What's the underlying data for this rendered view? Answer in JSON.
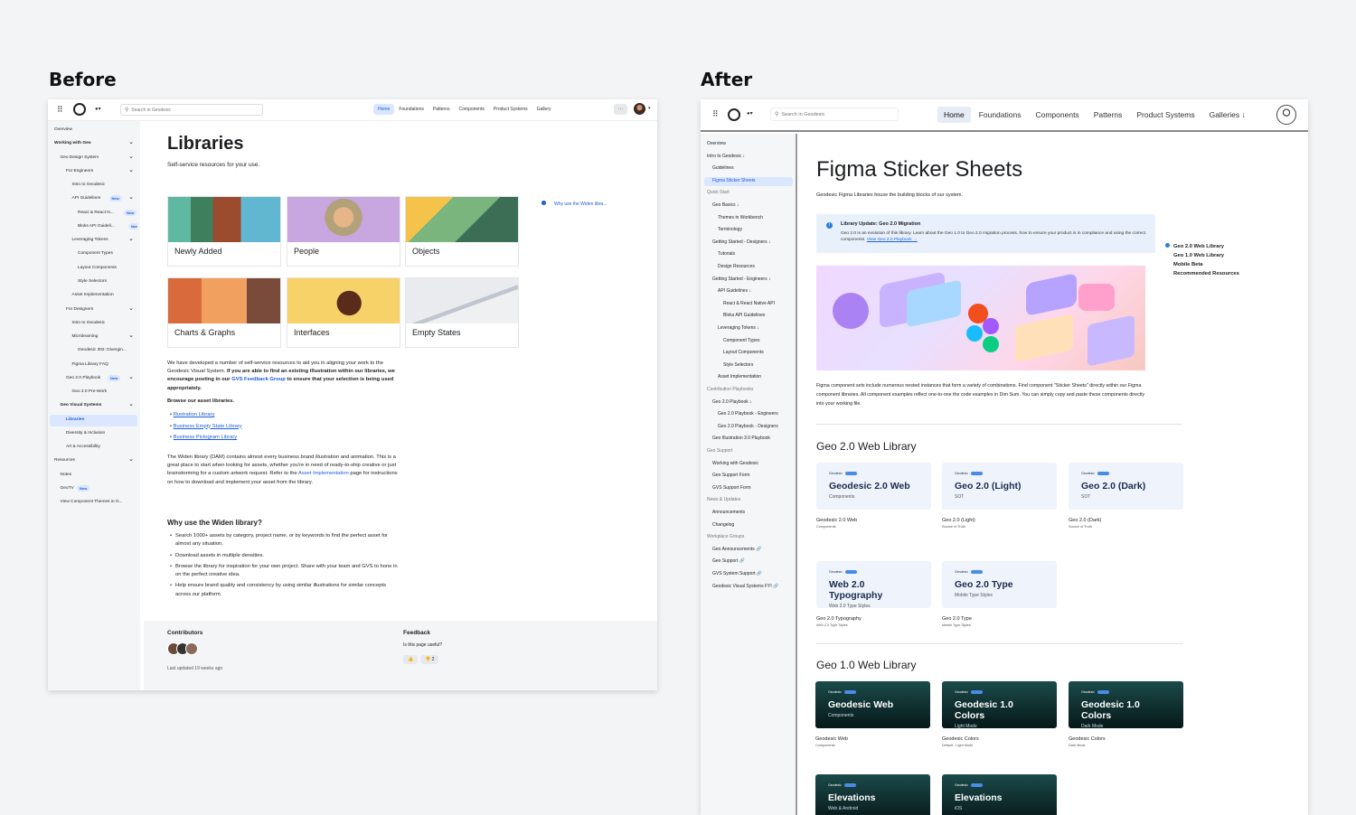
{
  "labels": {
    "before": "Before",
    "after": "After"
  },
  "before": {
    "nav": {
      "search_placeholder": "Search in Geodesic",
      "links": [
        "Home",
        "Foundations",
        "Patterns",
        "Components",
        "Product Systems",
        "Gallery"
      ],
      "more": "···"
    },
    "sidebar": [
      {
        "label": "Overview",
        "indent": 0
      },
      {
        "label": "Working with Geo",
        "indent": 0,
        "bold": true,
        "chev": true
      },
      {
        "label": "Geo Design System",
        "indent": 1,
        "chev": true
      },
      {
        "label": "For Engineers",
        "indent": 2,
        "chev": true
      },
      {
        "label": "Intro to Geodesic",
        "indent": 3
      },
      {
        "label": "API Guidelines",
        "indent": 3,
        "badge": "New",
        "chev": true
      },
      {
        "label": "React & React N...",
        "indent": 4,
        "badge": "New"
      },
      {
        "label": "Bloks API Guideli...",
        "indent": 4,
        "badge": "New"
      },
      {
        "label": "Leveraging Tokens",
        "indent": 3,
        "chev": true
      },
      {
        "label": "Component Types",
        "indent": 4
      },
      {
        "label": "Layout Components",
        "indent": 4
      },
      {
        "label": "Style Selectors",
        "indent": 4
      },
      {
        "label": "Asset Implementation",
        "indent": 3
      },
      {
        "label": "For Designers",
        "indent": 2,
        "chev": true
      },
      {
        "label": "Intro to Geodesic",
        "indent": 3
      },
      {
        "label": "Microlearning",
        "indent": 3,
        "chev": true
      },
      {
        "label": "Geodesic 302: Divergin...",
        "indent": 4
      },
      {
        "label": "Figma Library FAQ",
        "indent": 3
      },
      {
        "label": "Geo 2.0 Playbook",
        "indent": 2,
        "badge": "New",
        "chev": true
      },
      {
        "label": "Geo 2.0 Pre-Work",
        "indent": 3
      },
      {
        "label": "Geo Visual Systems",
        "indent": 1,
        "bold": true,
        "chev": true
      },
      {
        "label": "Libraries",
        "indent": 2,
        "active": true
      },
      {
        "label": "Diversity & Inclusion",
        "indent": 2
      },
      {
        "label": "Art & Accessibility",
        "indent": 2
      },
      {
        "label": "Resources",
        "indent": 0,
        "chev": true
      },
      {
        "label": "Notes",
        "indent": 1
      },
      {
        "label": "GeoTV",
        "indent": 1,
        "badge": "New"
      },
      {
        "label": "View Component Themes in G...",
        "indent": 1
      }
    ],
    "title": "Libraries",
    "subtitle": "Self-service resources for your use.",
    "toc": "Why use the Widen libra...",
    "cards": [
      "Newly Added",
      "People",
      "Objects",
      "Charts & Graphs",
      "Interfaces",
      "Empty States"
    ],
    "para1_a": "We have developed a number of self-service resources to aid you in aligning your work to the Geodesic Visual System.",
    "para1_b": "If you are able to find an existing illustration within our libraries, we encourage posting in our",
    "para1_link": "GVS Feedback Group",
    "para1_c": "to ensure that your selection is being used appropriately.",
    "browse": "Browse our asset libraries.",
    "links": [
      "Illustration Library",
      "Business Empty State Library",
      "Business Pictogram Library"
    ],
    "para2_a": "The Widen library (DAM) contains almost every business brand illustration and animation. This is a great place to start when looking for assets, whether you're in need of ready-to-ship creative or just brainstorming for a custom artwork request. Refer to the",
    "para2_link": "Asset Implementation",
    "para2_b": "page for instructions on how to download and implement your asset from the library.",
    "why_title": "Why use the Widen library?",
    "bullets": [
      "Search 1000+ assets by category, project name, or by keywords to find the perfect asset for almost any situation.",
      "Download assets in multiple densities.",
      "Browse the library for inspiration for your own project. Share with your team and GVS to hone in on the perfect creative idea.",
      "Help ensure brand quality and consistency by using similar illustrations for similar concepts across our platform."
    ],
    "contributors": "Contributors",
    "updated": "Last updated 19 weeks ago",
    "feedback": "Feedback",
    "useful": "Is this page useful?",
    "down_count": "2"
  },
  "after": {
    "nav": {
      "search_placeholder": "Search in Geodesic",
      "links": [
        "Home",
        "Foundations",
        "Components",
        "Patterns",
        "Product Systems",
        "Galleries ↓"
      ]
    },
    "sidebar": [
      {
        "label": "Overview",
        "i": 0
      },
      {
        "label": "Intro to Geodesic ↓",
        "i": 0
      },
      {
        "label": "Guidelines",
        "i": 1
      },
      {
        "label": "Figma Sticker Sheets",
        "i": 1,
        "active": true
      },
      {
        "label": "Quick Start",
        "i": 0,
        "sec": true
      },
      {
        "label": "Geo Basics ↓",
        "i": 1
      },
      {
        "label": "Themes in Workbench",
        "i": 2
      },
      {
        "label": "Terminology",
        "i": 2
      },
      {
        "label": "Getting Started - Designers ↓",
        "i": 1
      },
      {
        "label": "Tutorials",
        "i": 2
      },
      {
        "label": "Design Resources",
        "i": 2
      },
      {
        "label": "Getting Started - Engineers ↓",
        "i": 1
      },
      {
        "label": "API Guidelines ↓",
        "i": 2
      },
      {
        "label": "React & React Native API",
        "i": 3
      },
      {
        "label": "Bloks API Guidelines",
        "i": 3
      },
      {
        "label": "Leveraging Tokens ↓",
        "i": 2
      },
      {
        "label": "Component Types",
        "i": 3
      },
      {
        "label": "Layout Components",
        "i": 3
      },
      {
        "label": "Style Selectors",
        "i": 3
      },
      {
        "label": "Asset Implementation",
        "i": 2
      },
      {
        "label": "Contribution Playbooks",
        "i": 0,
        "sec": true
      },
      {
        "label": "Geo 2.0 Playbook ↓",
        "i": 1
      },
      {
        "label": "Geo 2.0 Playbook - Engineers",
        "i": 2
      },
      {
        "label": "Geo 2.0 Playbook - Designers",
        "i": 2
      },
      {
        "label": "Geo Illustration 3.0 Playbook",
        "i": 1
      },
      {
        "label": "Geo Support",
        "i": 0,
        "sec": true
      },
      {
        "label": "Working with Geodesic",
        "i": 1
      },
      {
        "label": "Geo Support Form",
        "i": 1
      },
      {
        "label": "GVS Support Form",
        "i": 1
      },
      {
        "label": "News & Updates",
        "i": 0,
        "sec": true
      },
      {
        "label": "Announcements",
        "i": 1
      },
      {
        "label": "Changelog",
        "i": 1
      },
      {
        "label": "Workplace Groups",
        "i": 0,
        "sec": true
      },
      {
        "label": "Geo Announcements 🔗",
        "i": 1
      },
      {
        "label": "Geo Support 🔗",
        "i": 1
      },
      {
        "label": "GVS System Support 🔗",
        "i": 1
      },
      {
        "label": "Geodesic Visual Systems FYI 🔗",
        "i": 1
      }
    ],
    "title": "Figma Sticker Sheets",
    "subtitle": "Geodesic Figma Libraries house the building blocks of our system.",
    "callout_title": "Library Update: Geo 2.0 Migration",
    "callout_body": "Geo 2.0 is an evolution of this library. Learn about the Geo 1.0 to Geo 2.0 migration process, how to ensure your product is in compliance and using the correct components.",
    "callout_link": "View Geo 2.0 Playbook →",
    "toc": [
      "Geo 2.0 Web Library",
      "Geo 1.0 Web Library",
      "Mobile Beta",
      "Recommended Resources"
    ],
    "body": "Figma component sets include numerous nested instances that form a variety of combinations. Find component \"Sticker Sheets\" directly within our Figma component libraries. All component examples reflect one-to-one the code examples in Dim Sum. You can simply copy and paste these components directly into your working file.",
    "sec1": "Geo 2.0 Web Library",
    "sec2": "Geo 1.0 Web Library",
    "mini_brand": "Geodesic",
    "lib2": [
      {
        "t": "Geodesic 2.0 Web",
        "s": "Components",
        "c1": "Geodesic 2.0 Web",
        "c2": "Components"
      },
      {
        "t": "Geo 2.0 (Light)",
        "s": "SOT",
        "c1": "Geo 2.0 (Light)",
        "c2": "Source of Truth"
      },
      {
        "t": "Geo 2.0 (Dark)",
        "s": "SOT",
        "c1": "Geo 2.0 (Dark)",
        "c2": "Source of Truth"
      },
      {
        "t": "Web 2.0 Typography",
        "s": "Web 2.0 Type Styles",
        "c1": "Geo 2.0 Typography",
        "c2": "Web 2.0 Type Styles"
      },
      {
        "t": "Geo 2.0 Type",
        "s": "Mobile Type Styles",
        "c1": "Geo 2.0 Type",
        "c2": "Mobile Type Styles"
      }
    ],
    "lib1": [
      {
        "t": "Geodesic Web",
        "s": "Components",
        "c1": "Geodesic Web",
        "c2": "Components"
      },
      {
        "t": "Geodesic 1.0 Colors",
        "s": "Light Mode",
        "c1": "Geodesic Colors",
        "c2": "Default - Light Mode"
      },
      {
        "t": "Geodesic 1.0 Colors",
        "s": "Dark Mode",
        "c1": "Geodesic Colors",
        "c2": "Dark Mode"
      },
      {
        "t": "Elevations",
        "s": "Web & Android"
      },
      {
        "t": "Elevations",
        "s": "iOS"
      }
    ]
  }
}
